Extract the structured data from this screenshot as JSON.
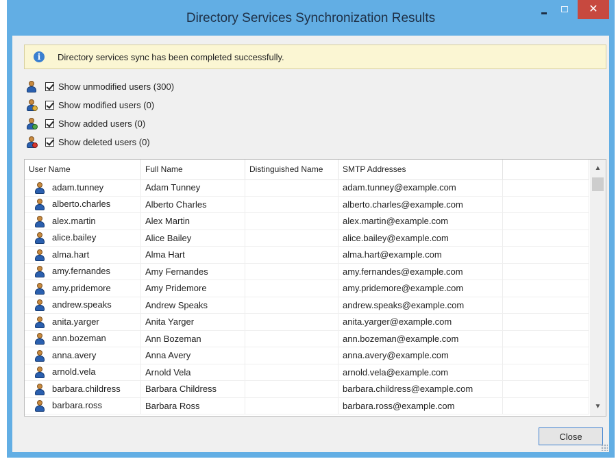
{
  "window": {
    "title": "Directory Services Synchronization Results",
    "close_glyph": "✕",
    "accent": "#62aee4",
    "close_color": "#c7493f"
  },
  "info": {
    "icon": "info-icon",
    "glyph": "i",
    "message": "Directory services sync has been completed successfully."
  },
  "filters": [
    {
      "icon": "user-icon",
      "label": "Show unmodified users (300)",
      "checked": true
    },
    {
      "icon": "user-modified-icon",
      "label": "Show modified users (0)",
      "checked": true
    },
    {
      "icon": "user-added-icon",
      "label": "Show added users (0)",
      "checked": true
    },
    {
      "icon": "user-deleted-icon",
      "label": "Show deleted users (0)",
      "checked": true
    }
  ],
  "grid": {
    "columns": [
      "User Name",
      "Full Name",
      "Distinguished Name",
      "SMTP Addresses",
      ""
    ],
    "rows": [
      {
        "user": "adam.tunney",
        "full": "Adam Tunney",
        "dn": "",
        "smtp": "adam.tunney@example.com"
      },
      {
        "user": "alberto.charles",
        "full": "Alberto Charles",
        "dn": "",
        "smtp": "alberto.charles@example.com"
      },
      {
        "user": "alex.martin",
        "full": "Alex Martin",
        "dn": "",
        "smtp": "alex.martin@example.com"
      },
      {
        "user": "alice.bailey",
        "full": "Alice Bailey",
        "dn": "",
        "smtp": "alice.bailey@example.com"
      },
      {
        "user": "alma.hart",
        "full": "Alma Hart",
        "dn": "",
        "smtp": "alma.hart@example.com"
      },
      {
        "user": "amy.fernandes",
        "full": "Amy Fernandes",
        "dn": "",
        "smtp": "amy.fernandes@example.com"
      },
      {
        "user": "amy.pridemore",
        "full": "Amy Pridemore",
        "dn": "",
        "smtp": "amy.pridemore@example.com"
      },
      {
        "user": "andrew.speaks",
        "full": "Andrew Speaks",
        "dn": "",
        "smtp": "andrew.speaks@example.com"
      },
      {
        "user": "anita.yarger",
        "full": "Anita Yarger",
        "dn": "",
        "smtp": "anita.yarger@example.com"
      },
      {
        "user": "ann.bozeman",
        "full": "Ann Bozeman",
        "dn": "",
        "smtp": "ann.bozeman@example.com"
      },
      {
        "user": "anna.avery",
        "full": "Anna Avery",
        "dn": "",
        "smtp": "anna.avery@example.com"
      },
      {
        "user": "arnold.vela",
        "full": "Arnold Vela",
        "dn": "",
        "smtp": "arnold.vela@example.com"
      },
      {
        "user": "barbara.childress",
        "full": "Barbara Childress",
        "dn": "",
        "smtp": "barbara.childress@example.com"
      },
      {
        "user": "barbara.ross",
        "full": "Barbara Ross",
        "dn": "",
        "smtp": "barbara.ross@example.com"
      }
    ]
  },
  "scrollbar": {
    "up_glyph": "▲",
    "down_glyph": "▼"
  },
  "footer": {
    "close_label": "Close"
  }
}
